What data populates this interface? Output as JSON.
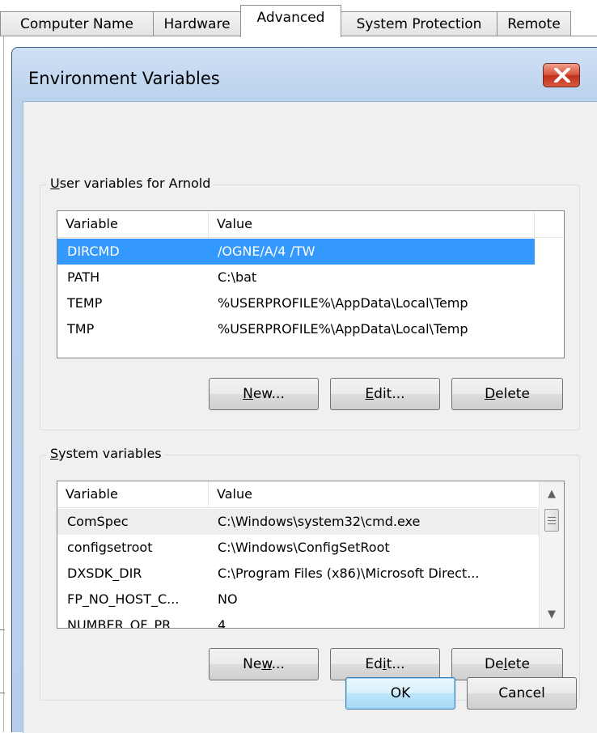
{
  "tabs": [
    {
      "label": "Computer Name",
      "active": false
    },
    {
      "label": "Hardware",
      "active": false
    },
    {
      "label": "Advanced",
      "active": true
    },
    {
      "label": "System Protection",
      "active": false
    },
    {
      "label": "Remote",
      "active": false
    }
  ],
  "dialog": {
    "title": "Environment Variables",
    "close_icon": "close-x-icon"
  },
  "user_vars": {
    "group_label_key": "U",
    "group_label_rest": "ser variables for Arnold",
    "columns": [
      "Variable",
      "Value"
    ],
    "rows": [
      {
        "variable": "DIRCMD",
        "value": "/OGNE/A/4 /TW",
        "selected": true
      },
      {
        "variable": "PATH",
        "value": "C:\\bat"
      },
      {
        "variable": "TEMP",
        "value": "%USERPROFILE%\\AppData\\Local\\Temp"
      },
      {
        "variable": "TMP",
        "value": "%USERPROFILE%\\AppData\\Local\\Temp"
      }
    ],
    "buttons": {
      "new_pre": "",
      "new_key": "N",
      "new_post": "ew...",
      "edit_pre": "",
      "edit_key": "E",
      "edit_post": "dit...",
      "delete_pre": "",
      "delete_key": "D",
      "delete_post": "elete"
    }
  },
  "system_vars": {
    "group_label_key": "S",
    "group_label_rest": "ystem variables",
    "columns": [
      "Variable",
      "Value"
    ],
    "rows": [
      {
        "variable": "ComSpec",
        "value": "C:\\Windows\\system32\\cmd.exe",
        "hot": true
      },
      {
        "variable": "configsetroot",
        "value": "C:\\Windows\\ConfigSetRoot"
      },
      {
        "variable": "DXSDK_DIR",
        "value": "C:\\Program Files (x86)\\Microsoft Direct..."
      },
      {
        "variable": "FP_NO_HOST_C...",
        "value": "NO"
      },
      {
        "variable": "NUMBER_OF_PR...",
        "value": "4"
      }
    ],
    "buttons": {
      "new_pre": "Ne",
      "new_key": "w",
      "new_post": "...",
      "edit_pre": "Ed",
      "edit_key": "i",
      "edit_post": "t...",
      "delete_pre": "De",
      "delete_key": "l",
      "delete_post": "ete"
    },
    "scroll_up_icon": "arrow-up-icon",
    "scroll_down_icon": "arrow-down-icon"
  },
  "footer": {
    "ok_label": "OK",
    "cancel_label": "Cancel"
  }
}
